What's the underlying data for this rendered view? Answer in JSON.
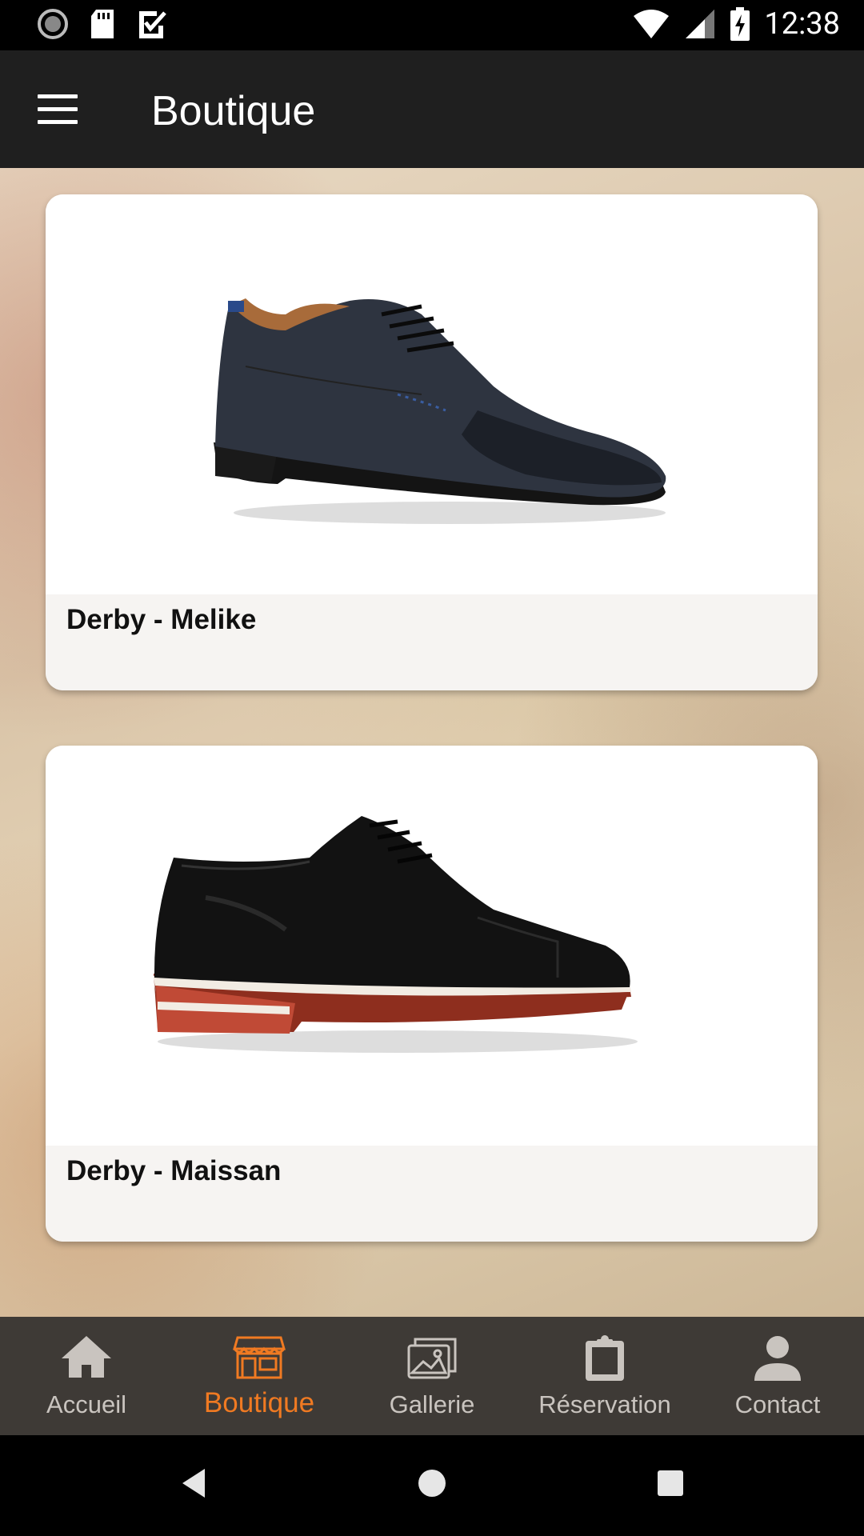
{
  "status_bar": {
    "time": "12:38",
    "left_icons": [
      "sync-icon",
      "sd-card-icon",
      "checkbox-icon"
    ],
    "right_icons": [
      "wifi-icon",
      "signal-icon",
      "battery-charging-icon"
    ]
  },
  "app_bar": {
    "menu_icon": "menu-icon",
    "title": "Boutique"
  },
  "products": [
    {
      "name": "Derby - Melike",
      "image": "navy-derby-shoe"
    },
    {
      "name": "Derby - Maissan",
      "image": "black-derby-shoe-red-sole"
    }
  ],
  "bottom_nav": {
    "items": [
      {
        "label": "Accueil",
        "icon": "home-icon",
        "active": false
      },
      {
        "label": "Boutique",
        "icon": "store-icon",
        "active": true
      },
      {
        "label": "Gallerie",
        "icon": "gallery-icon",
        "active": false
      },
      {
        "label": "Réservation",
        "icon": "clipboard-icon",
        "active": false
      },
      {
        "label": "Contact",
        "icon": "person-icon",
        "active": false
      }
    ]
  },
  "colors": {
    "app_bar": "#1f1f1f",
    "accent": "#f07a22",
    "nav_background": "#3e3a36",
    "nav_inactive": "#c9c4bf"
  }
}
